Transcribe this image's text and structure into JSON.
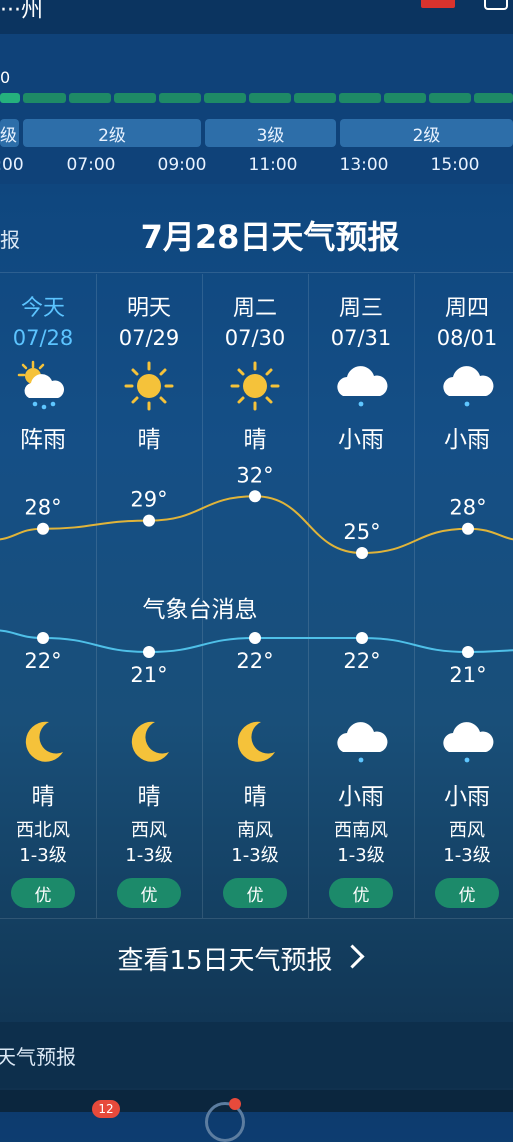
{
  "top": {
    "title": "···州"
  },
  "hourly": {
    "zero_label": "0",
    "wind_levels": [
      "级",
      "2级",
      "3级",
      "2级"
    ],
    "times": [
      ":00",
      "07:00",
      "09:00",
      "11:00",
      "13:00",
      "15:00"
    ]
  },
  "forecast": {
    "side_label": "报",
    "title": "7月28日天气预报",
    "notice": "气象台消息",
    "more_label": "查看15日天气预报",
    "days": [
      {
        "name": "今天",
        "date": "07/28",
        "day_weather": "阵雨",
        "day_icon": "sun-cloud-rain-icon",
        "high": "28°",
        "low": "22°",
        "night_weather": "晴",
        "night_icon": "moon-icon",
        "wind": "西北风",
        "wind_level": "1-3级",
        "aqi": "优"
      },
      {
        "name": "明天",
        "date": "07/29",
        "day_weather": "晴",
        "day_icon": "sun-icon",
        "high": "29°",
        "low": "21°",
        "night_weather": "晴",
        "night_icon": "moon-icon",
        "wind": "西风",
        "wind_level": "1-3级",
        "aqi": "优"
      },
      {
        "name": "周二",
        "date": "07/30",
        "day_weather": "晴",
        "day_icon": "sun-icon",
        "high": "32°",
        "low": "22°",
        "night_weather": "晴",
        "night_icon": "moon-icon",
        "wind": "南风",
        "wind_level": "1-3级",
        "aqi": "优"
      },
      {
        "name": "周三",
        "date": "07/31",
        "day_weather": "小雨",
        "day_icon": "cloud-rain-icon",
        "high": "25°",
        "low": "22°",
        "night_weather": "小雨",
        "night_icon": "cloud-rain-icon",
        "wind": "西南风",
        "wind_level": "1-3级",
        "aqi": "优"
      },
      {
        "name": "周四",
        "date": "08/01",
        "day_weather": "小雨",
        "day_icon": "cloud-rain-icon",
        "high": "28°",
        "low": "21°",
        "night_weather": "小雨",
        "night_icon": "cloud-rain-icon",
        "wind": "西风",
        "wind_level": "1-3级",
        "aqi": "优"
      }
    ]
  },
  "footer": {
    "label": "天气预报",
    "nav_badge": "12"
  },
  "colors": {
    "high_line": "#e0b43a",
    "low_line": "#4fc0e8",
    "today": "#5cc4ff",
    "aqi": "#1c8a6a"
  }
}
